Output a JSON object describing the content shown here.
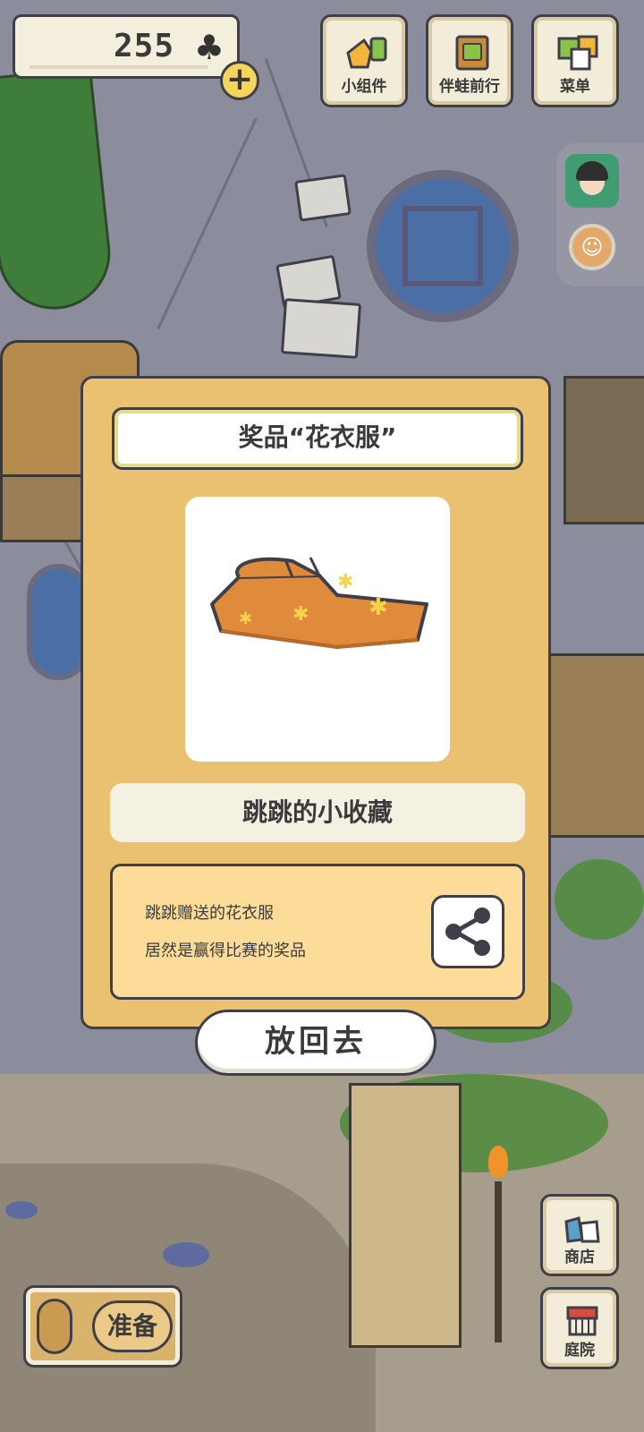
{
  "hud": {
    "clover_count": "255",
    "top_buttons": [
      {
        "label": "小组件",
        "icon": "widget-icon"
      },
      {
        "label": "伴蛙前行",
        "icon": "journey-book-icon"
      },
      {
        "label": "菜单",
        "icon": "menu-cards-icon"
      }
    ],
    "bottom": {
      "prepare_label": "准备",
      "shop_label": "商店",
      "yard_label": "庭院"
    }
  },
  "modal": {
    "title": "奖品“花衣服”",
    "item_icon": "flower-clothes-icon",
    "item_color": "#e08a3c",
    "collection_name": "跳跳的小收藏",
    "description_lines": [
      "跳跳赠送的花衣服",
      "居然是赢得比赛的奖品"
    ],
    "share_icon": "share-icon",
    "put_back_label": "放回去"
  },
  "colors": {
    "panel": "#eac170",
    "desc_bg": "#fcdc98",
    "outline": "#3f3f4a"
  }
}
